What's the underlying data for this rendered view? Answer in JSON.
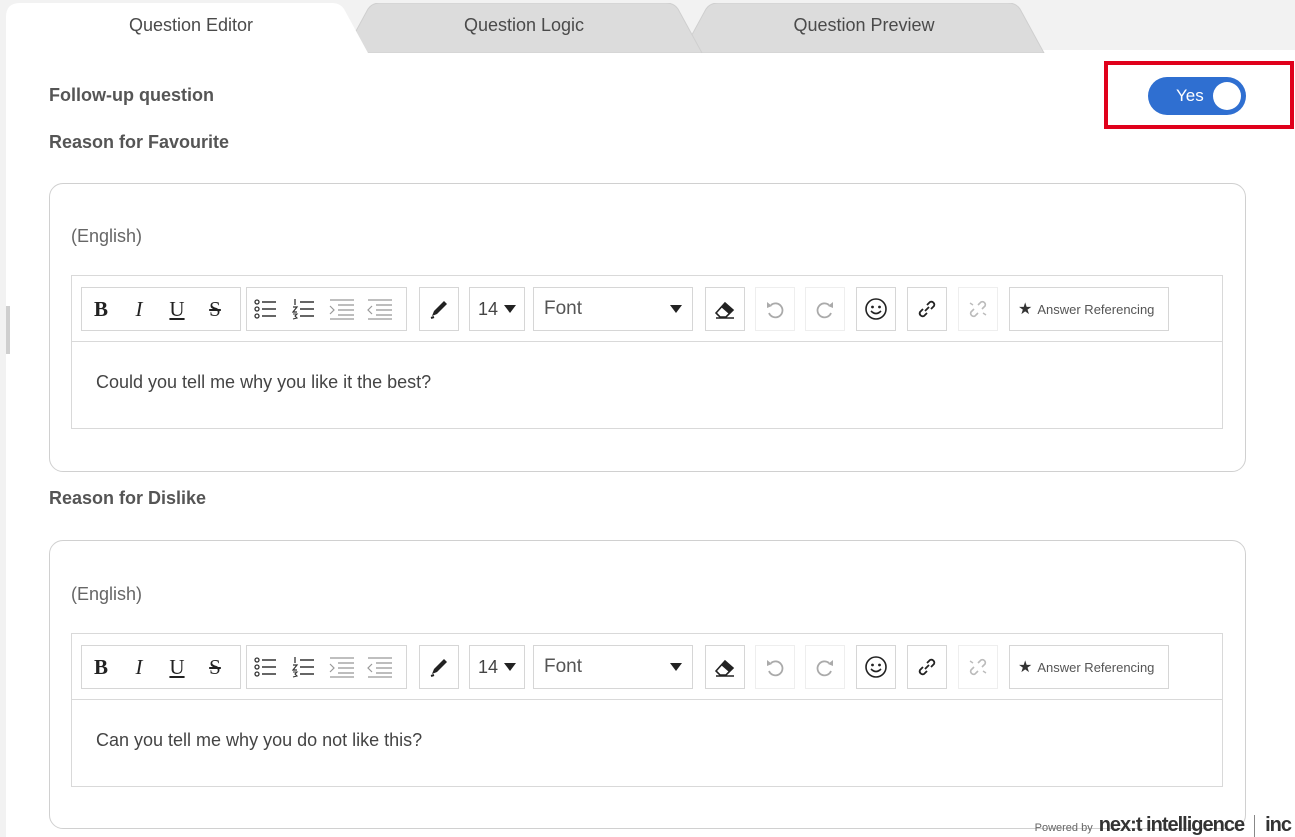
{
  "tabs": [
    {
      "label": "Question Editor",
      "active": true
    },
    {
      "label": "Question Logic",
      "active": false
    },
    {
      "label": "Question Preview",
      "active": false
    }
  ],
  "followup": {
    "label": "Follow-up question",
    "toggle_label": "Yes",
    "toggle_on": true,
    "toggle_color": "#2f6fd1"
  },
  "highlight_color": "#e0001b",
  "sections": [
    {
      "label": "Reason for Favourite",
      "language": "(English)",
      "toolbar": {
        "font_size": "14",
        "font": "Font",
        "answer_ref": "Answer Referencing"
      },
      "content": "Could you tell me why you like it the best?"
    },
    {
      "label": "Reason for Dislike",
      "language": "(English)",
      "toolbar": {
        "font_size": "14",
        "font": "Font",
        "answer_ref": "Answer Referencing"
      },
      "content": "Can you tell me why you do not like this?"
    }
  ],
  "toolbar_glyphs": {
    "bold": "B",
    "italic": "I",
    "underline": "U",
    "strike": "S"
  },
  "footer": {
    "powered_by": "Powered by",
    "brand": "nex:t intelligence",
    "suffix": "inc"
  }
}
